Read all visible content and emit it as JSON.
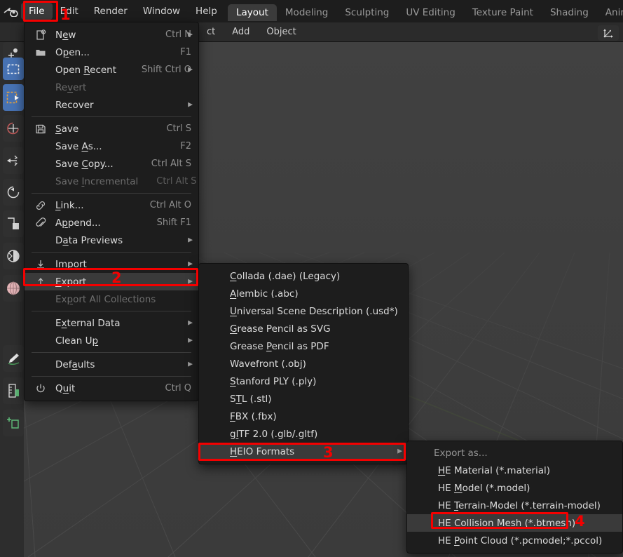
{
  "app": {
    "logo_icon": "blender-logo-icon",
    "accent_color": "#4772b3",
    "annotation_color": "#f40000"
  },
  "topbar": {
    "menus": [
      {
        "label": "File",
        "active": true
      },
      {
        "label": "Edit",
        "active": false
      },
      {
        "label": "Render",
        "active": false
      },
      {
        "label": "Window",
        "active": false
      },
      {
        "label": "Help",
        "active": false
      }
    ],
    "workspace_tabs": [
      {
        "label": "Layout",
        "active": true
      },
      {
        "label": "Modeling",
        "active": false
      },
      {
        "label": "Sculpting",
        "active": false
      },
      {
        "label": "UV Editing",
        "active": false
      },
      {
        "label": "Texture Paint",
        "active": false
      },
      {
        "label": "Shading",
        "active": false
      },
      {
        "label": "Animation",
        "active": false
      }
    ]
  },
  "header2": {
    "items": [
      {
        "label": "ct"
      },
      {
        "label": "Add"
      },
      {
        "label": "Object"
      }
    ],
    "gizmo_icon": "transform-orientation-gizmo-icon"
  },
  "toolshelf": {
    "tools": [
      {
        "name": "cursor-tool",
        "icon": "cursor-icon",
        "selected": false
      },
      {
        "name": "select-box-tool",
        "icon": "select-box-icon",
        "selected": true
      },
      {
        "name": "tweak-tool",
        "icon": "tweak-icon",
        "selected": true
      },
      {
        "name": "annotate-tool",
        "icon": "annotate-circle-icon",
        "selected": false
      },
      {
        "name": "move-tool",
        "icon": "move-arrows-icon",
        "selected": false
      },
      {
        "name": "rotate-tool",
        "icon": "rotate-icon",
        "selected": false
      },
      {
        "name": "scale-tool",
        "icon": "scale-icon",
        "selected": false
      },
      {
        "name": "transform-tool",
        "icon": "transform-icon",
        "selected": false
      },
      {
        "name": "shading-ball-tool",
        "icon": "sphere-icon",
        "selected": false
      },
      {
        "name": "annotate-pen-tool",
        "icon": "pen-icon",
        "selected": false
      },
      {
        "name": "measure-tool",
        "icon": "ruler-icon",
        "selected": false
      },
      {
        "name": "add-cube-tool",
        "icon": "add-cube-icon",
        "selected": false
      }
    ]
  },
  "file_menu": {
    "items": [
      {
        "label": "New",
        "icon": "new-file-icon",
        "shortcut": "Ctrl N",
        "arrow": true,
        "disabled": false,
        "mnemonic": 1
      },
      {
        "label": "Open...",
        "icon": "folder-icon",
        "shortcut": "F1",
        "arrow": false,
        "disabled": false,
        "mnemonic": 1
      },
      {
        "label": "Open Recent",
        "icon": "",
        "shortcut": "Shift Ctrl O",
        "arrow": true,
        "disabled": false,
        "mnemonic": 5
      },
      {
        "label": "Revert",
        "icon": "",
        "shortcut": "",
        "arrow": false,
        "disabled": true,
        "mnemonic": 2
      },
      {
        "label": "Recover",
        "icon": "",
        "shortcut": "",
        "arrow": true,
        "disabled": false,
        "mnemonic": -1
      },
      {
        "separator": true
      },
      {
        "label": "Save",
        "icon": "floppy-icon",
        "shortcut": "Ctrl S",
        "arrow": false,
        "disabled": false,
        "mnemonic": 0
      },
      {
        "label": "Save As...",
        "icon": "",
        "shortcut": "F2",
        "arrow": false,
        "disabled": false,
        "mnemonic": 5
      },
      {
        "label": "Save Copy...",
        "icon": "",
        "shortcut": "Ctrl Alt S",
        "arrow": false,
        "disabled": false,
        "mnemonic": 5
      },
      {
        "label": "Save Incremental",
        "icon": "",
        "shortcut": "Ctrl Alt S",
        "arrow": false,
        "disabled": true,
        "mnemonic": 5
      },
      {
        "separator": true
      },
      {
        "label": "Link...",
        "icon": "link-icon",
        "shortcut": "Ctrl Alt O",
        "arrow": false,
        "disabled": false,
        "mnemonic": 0
      },
      {
        "label": "Append...",
        "icon": "paperclip-icon",
        "shortcut": "Shift F1",
        "arrow": false,
        "disabled": false,
        "mnemonic": 1
      },
      {
        "label": "Data Previews",
        "icon": "",
        "shortcut": "",
        "arrow": true,
        "disabled": false,
        "mnemonic": 1
      },
      {
        "separator": true
      },
      {
        "label": "Import",
        "icon": "import-icon",
        "shortcut": "",
        "arrow": true,
        "disabled": false,
        "mnemonic": 2
      },
      {
        "label": "Export",
        "icon": "export-icon",
        "shortcut": "",
        "arrow": true,
        "disabled": false,
        "mnemonic": 0,
        "highlighted": true
      },
      {
        "label": "Export All Collections",
        "icon": "",
        "shortcut": "",
        "arrow": false,
        "disabled": true,
        "mnemonic": 2
      },
      {
        "separator": true
      },
      {
        "label": "External Data",
        "icon": "",
        "shortcut": "",
        "arrow": true,
        "disabled": false,
        "mnemonic": 1
      },
      {
        "label": "Clean Up",
        "icon": "",
        "shortcut": "",
        "arrow": true,
        "disabled": false,
        "mnemonic": 7
      },
      {
        "separator": true
      },
      {
        "label": "Defaults",
        "icon": "",
        "shortcut": "",
        "arrow": true,
        "disabled": false,
        "mnemonic": 3
      },
      {
        "separator": true
      },
      {
        "label": "Quit",
        "icon": "power-icon",
        "shortcut": "Ctrl Q",
        "arrow": false,
        "disabled": false,
        "mnemonic": 1
      }
    ]
  },
  "export_menu": {
    "items": [
      {
        "label": "Collada (.dae) (Legacy)",
        "arrow": false,
        "mnemonic": 0,
        "highlighted": false
      },
      {
        "label": "Alembic (.abc)",
        "arrow": false,
        "mnemonic": 0,
        "highlighted": false
      },
      {
        "label": "Universal Scene Description (.usd*)",
        "arrow": false,
        "mnemonic": 0,
        "highlighted": false
      },
      {
        "label": "Grease Pencil as SVG",
        "arrow": false,
        "mnemonic": 0,
        "highlighted": false
      },
      {
        "label": "Grease Pencil as PDF",
        "arrow": false,
        "mnemonic": 7,
        "highlighted": false
      },
      {
        "label": "Wavefront (.obj)",
        "arrow": false,
        "mnemonic": -1,
        "highlighted": false
      },
      {
        "label": "Stanford PLY (.ply)",
        "arrow": false,
        "mnemonic": 0,
        "highlighted": false
      },
      {
        "label": "STL (.stl)",
        "arrow": false,
        "mnemonic": 1,
        "highlighted": false
      },
      {
        "label": "FBX (.fbx)",
        "arrow": false,
        "mnemonic": 0,
        "highlighted": false
      },
      {
        "label": "glTF 2.0 (.glb/.gltf)",
        "arrow": false,
        "mnemonic": 1,
        "highlighted": false
      },
      {
        "label": "HEIO Formats",
        "arrow": true,
        "mnemonic": 0,
        "highlighted": true
      }
    ]
  },
  "heio_menu": {
    "header": "Export as...",
    "items": [
      {
        "label": "HE Material (*.material)",
        "mnemonic": 0,
        "highlighted": false
      },
      {
        "label": "HE Model (*.model)",
        "mnemonic": 3,
        "highlighted": false
      },
      {
        "label": "HE Terrain-Model (*.terrain-model)",
        "mnemonic": 3,
        "highlighted": false
      },
      {
        "label": "HE Collision Mesh (*.btmesh)",
        "mnemonic": 3,
        "highlighted": true
      },
      {
        "label": "HE Point Cloud (*.pcmodel;*.pccol)",
        "mnemonic": 3,
        "highlighted": false
      }
    ]
  },
  "annotations": [
    {
      "number": "1",
      "target": "file-menu-button"
    },
    {
      "number": "2",
      "target": "file-menu-item-export"
    },
    {
      "number": "3",
      "target": "export-menu-item-heio-formats"
    },
    {
      "number": "4",
      "target": "heio-menu-item-collision-mesh"
    }
  ]
}
